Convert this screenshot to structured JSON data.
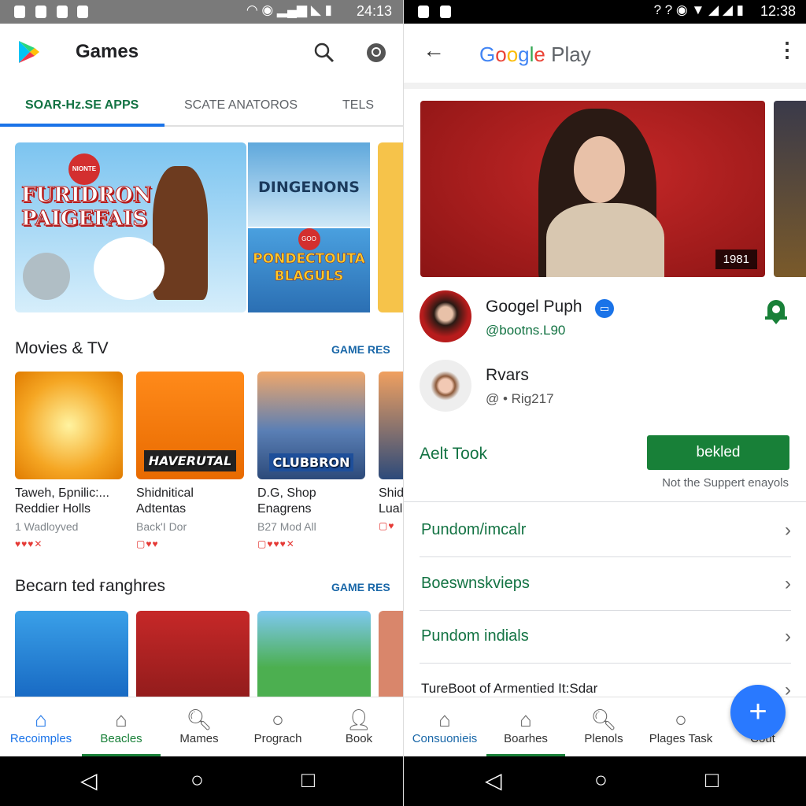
{
  "left": {
    "status": {
      "time": "24:13"
    },
    "header": {
      "title": "Games",
      "icons": [
        "play-logo",
        "search-icon",
        "account-icon"
      ]
    },
    "tabs": [
      "SOAR-Hz.SE APPS",
      "SCATE ANATOROS",
      "TELS"
    ],
    "banner": {
      "main_title": "FURIDRON PAIGEFAIS",
      "main_badge": "NIONTE",
      "side_top": "DINGENONS",
      "side_bottom": "PONDECTOUTA BLAGULS",
      "side_badge": "GOO"
    },
    "section1": {
      "title": "Movies & TV",
      "more": "GAME RES",
      "cards": [
        {
          "title1": "Taweh, Бpnilic:...",
          "title2": "Reddier Holls",
          "sub": "1 Wadloyved",
          "rating": "♥♥♥✕",
          "thumb_text": ""
        },
        {
          "title1": "Shidnitical",
          "title2": "Adtentas",
          "sub": "Back'I Dor",
          "rating": "▢♥♥",
          "thumb_text": "HAVERUTAL"
        },
        {
          "title1": "D.G, Shop",
          "title2": "Enagrens",
          "sub": "B27 Mod All",
          "rating": "▢♥♥♥✕",
          "thumb_text": "CLUBBRON"
        },
        {
          "title1": "Shid",
          "title2": "Lual",
          "sub": "",
          "rating": "▢♥",
          "thumb_text": ""
        }
      ]
    },
    "section2": {
      "title": "Becarn ted ғanghres",
      "more": "GAME RES"
    },
    "nav": [
      {
        "label": "Recoimples",
        "icon": "home-icon"
      },
      {
        "label": "Beacles",
        "icon": "store-icon"
      },
      {
        "label": "Mames",
        "icon": "search-icon"
      },
      {
        "label": "Prograch",
        "icon": "circle-icon"
      },
      {
        "label": "Book",
        "icon": "person-icon"
      }
    ]
  },
  "right": {
    "status": {
      "time": "12:38"
    },
    "header": {
      "logo": "Google Play",
      "logo_colors": [
        "#4285f4",
        "#ea4335",
        "#fbbc05",
        "#4285f4",
        "#34a853",
        "#ea4335"
      ]
    },
    "hero": {
      "badge": "1981"
    },
    "profiles": [
      {
        "name": "Googel Puph",
        "handle": "@bootns.L90"
      },
      {
        "name": "Rvars",
        "handle": "@ • Rig217"
      }
    ],
    "action": {
      "label": "Aelt Took",
      "button": "bekled",
      "note": "Not the Suppert enayols"
    },
    "list": [
      "Pundom/imcalr",
      "Boeswnskvieps",
      "Pundom indials",
      "TureBoot of Armentied It:Sdar"
    ],
    "nav": [
      {
        "label": "Consuonieis",
        "icon": "home-icon"
      },
      {
        "label": "Boarhes",
        "icon": "store-icon"
      },
      {
        "label": "Plenols",
        "icon": "search-icon"
      },
      {
        "label": "Plages Task",
        "icon": "circle-icon"
      },
      {
        "label": "Cout",
        "icon": "add-icon"
      }
    ]
  },
  "colors": {
    "accent_green": "#188038",
    "accent_blue": "#1a73e8",
    "fab": "#2979ff"
  }
}
